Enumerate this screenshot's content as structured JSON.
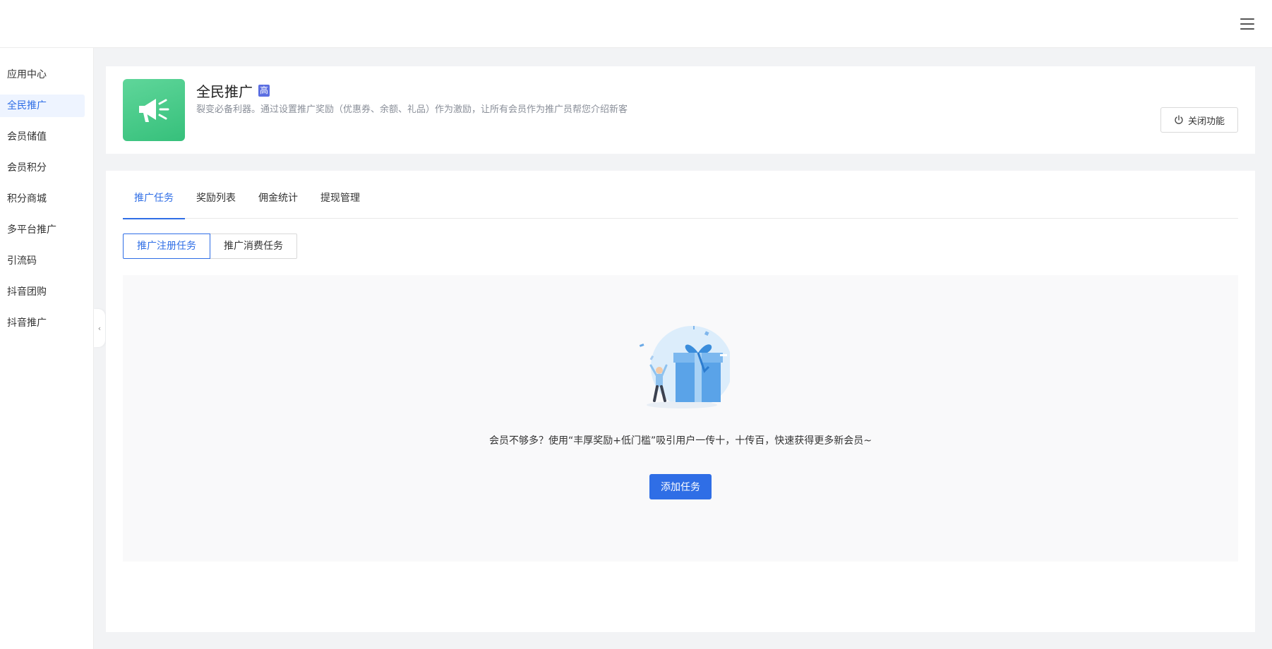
{
  "topbar": {
    "menu_icon": "hamburger-menu-icon"
  },
  "sidebar": {
    "items": [
      {
        "label": "应用中心",
        "active": false
      },
      {
        "label": "全民推广",
        "active": true
      },
      {
        "label": "会员储值",
        "active": false
      },
      {
        "label": "会员积分",
        "active": false
      },
      {
        "label": "积分商城",
        "active": false
      },
      {
        "label": "多平台推广",
        "active": false
      },
      {
        "label": "引流码",
        "active": false
      },
      {
        "label": "抖音团购",
        "active": false
      },
      {
        "label": "抖音推广",
        "active": false
      }
    ],
    "collapse_glyph": "‹"
  },
  "header": {
    "title": "全民推广",
    "badge": "高",
    "description": "裂变必备利器。通过设置推广奖励（优惠券、余额、礼品）作为激励，让所有会员作为推广员帮您介绍新客",
    "close_button": "关闭功能",
    "icon": "megaphone-icon"
  },
  "tabs": [
    {
      "label": "推广任务",
      "active": true
    },
    {
      "label": "奖励列表",
      "active": false
    },
    {
      "label": "佣金统计",
      "active": false
    },
    {
      "label": "提现管理",
      "active": false
    }
  ],
  "subtabs": [
    {
      "label": "推广注册任务",
      "active": true
    },
    {
      "label": "推广消费任务",
      "active": false
    }
  ],
  "empty_state": {
    "message": "会员不够多？使用“丰厚奖励+低门槛”吸引用户一传十，十传百，快速获得更多新会员~",
    "add_button": "添加任务",
    "illustration": "gift-celebration-illustration"
  },
  "colors": {
    "accent": "#2f6ee6",
    "app_icon_green": "#3cc47f",
    "badge_blue": "#5b6ee1"
  }
}
